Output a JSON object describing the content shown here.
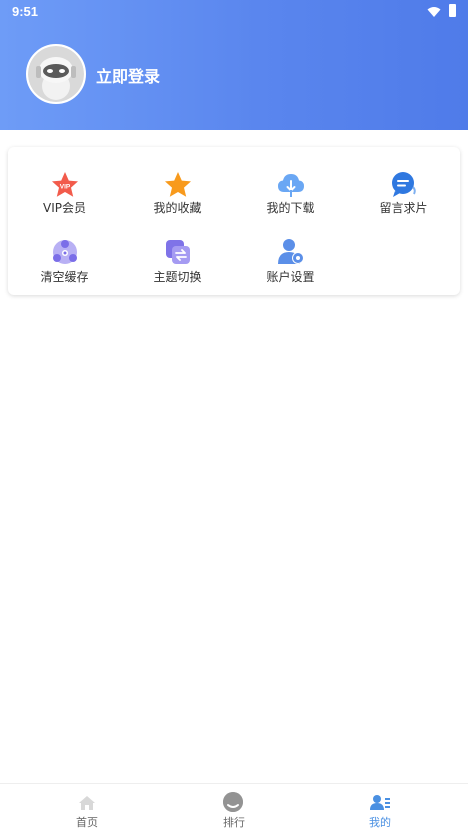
{
  "status_bar": {
    "time": "9:51"
  },
  "profile": {
    "login_label": "立即登录"
  },
  "menu": {
    "items": [
      {
        "label": "VIP会员",
        "icon": "vip-star-icon",
        "color": "#f25b4b"
      },
      {
        "label": "我的收藏",
        "icon": "star-icon",
        "color": "#f89a1c"
      },
      {
        "label": "我的下载",
        "icon": "cloud-download-icon",
        "color": "#6aa7f4"
      },
      {
        "label": "留言求片",
        "icon": "chat-bubble-icon",
        "color": "#2f78e0"
      },
      {
        "label": "清空缓存",
        "icon": "clear-cache-icon",
        "color": "#7b6ee8"
      },
      {
        "label": "主题切换",
        "icon": "theme-switch-icon",
        "color": "#7f73e8"
      },
      {
        "label": "账户设置",
        "icon": "account-settings-icon",
        "color": "#5b8fe8"
      }
    ]
  },
  "bottom_nav": {
    "items": [
      {
        "label": "首页",
        "icon": "home-icon",
        "active": false
      },
      {
        "label": "排行",
        "icon": "ranking-icon",
        "active": false
      },
      {
        "label": "我的",
        "icon": "profile-icon",
        "active": true
      }
    ],
    "active_color": "#4a90e2"
  }
}
